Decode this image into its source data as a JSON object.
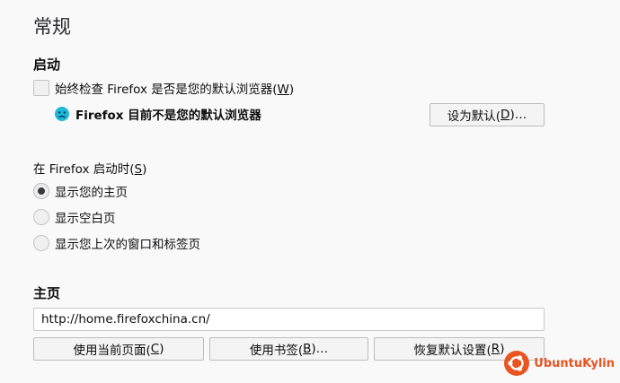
{
  "page_title": "常规",
  "startup": {
    "heading": "启动",
    "check_default": {
      "text": "始终检查 Firefox 是否是您的默认浏览器(",
      "key": "W",
      "end": ")",
      "checked": false
    },
    "not_default_note": "Firefox 目前不是您的默认浏览器",
    "set_default_button": {
      "text": "设为默认(",
      "key": "D",
      "end": ")…"
    }
  },
  "on_launch": {
    "label": {
      "text": "在 Firefox 启动时(",
      "key": "S",
      "end": ")"
    },
    "options": [
      {
        "label": "显示您的主页",
        "selected": true
      },
      {
        "label": "显示空白页",
        "selected": false
      },
      {
        "label": "显示您上次的窗口和标签页",
        "selected": false
      }
    ]
  },
  "homepage": {
    "heading": "主页",
    "url": "http://home.firefoxchina.cn/",
    "buttons": [
      {
        "text": "使用当前页面(",
        "key": "C",
        "end": ")"
      },
      {
        "text": "使用书签(",
        "key": "B",
        "end": ")…"
      },
      {
        "text": "恢复默认设置(",
        "key": "R",
        "end": ")"
      }
    ]
  },
  "watermark": {
    "brand": "UbuntuKylin",
    "color": "#e95420"
  }
}
